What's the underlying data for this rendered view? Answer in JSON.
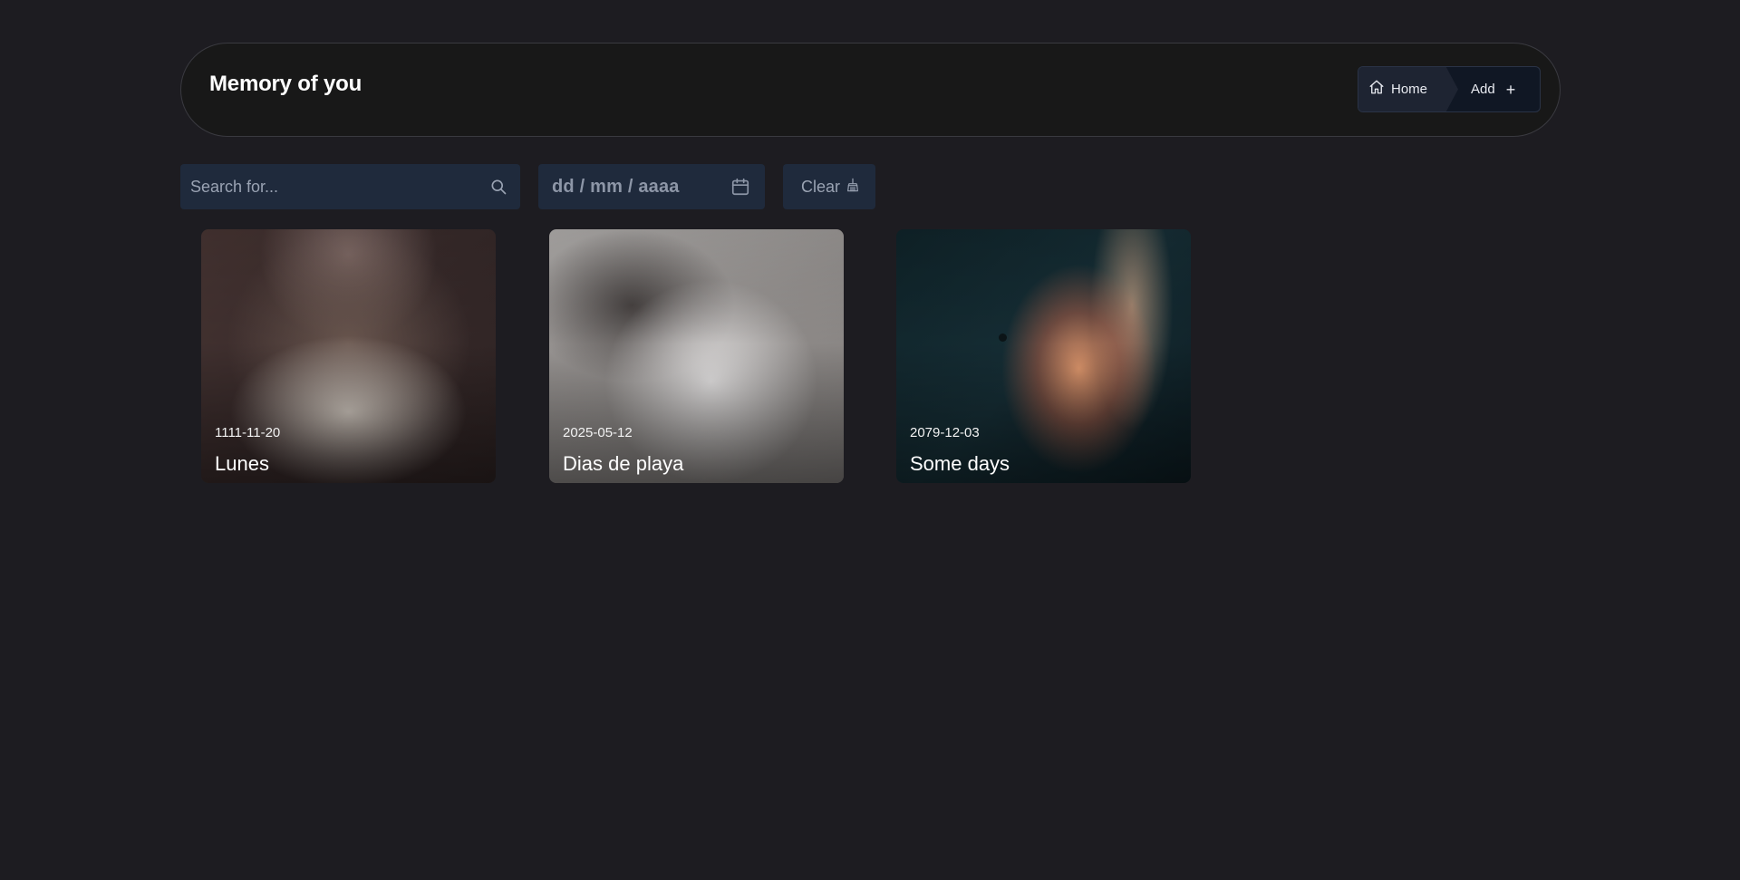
{
  "header": {
    "title": "Memory of you",
    "nav": {
      "home_label": "Home",
      "add_label": "Add"
    }
  },
  "toolbar": {
    "search_placeholder": "Search for...",
    "date_placeholder": "dd / mm / aaaa",
    "clear_label": "Clear"
  },
  "cards": [
    {
      "date": "1111-11-20",
      "title": "Lunes",
      "image": "kitten-photo"
    },
    {
      "date": "2025-05-12",
      "title": "Dias de playa",
      "image": "cat-photo"
    },
    {
      "date": "2079-12-03",
      "title": "Some days",
      "image": "black-hole-art"
    }
  ],
  "colors": {
    "background": "#1d1c21",
    "header_bg": "#181818",
    "control_bg": "#1f2a3c",
    "placeholder_text": "#9aa3b3"
  }
}
